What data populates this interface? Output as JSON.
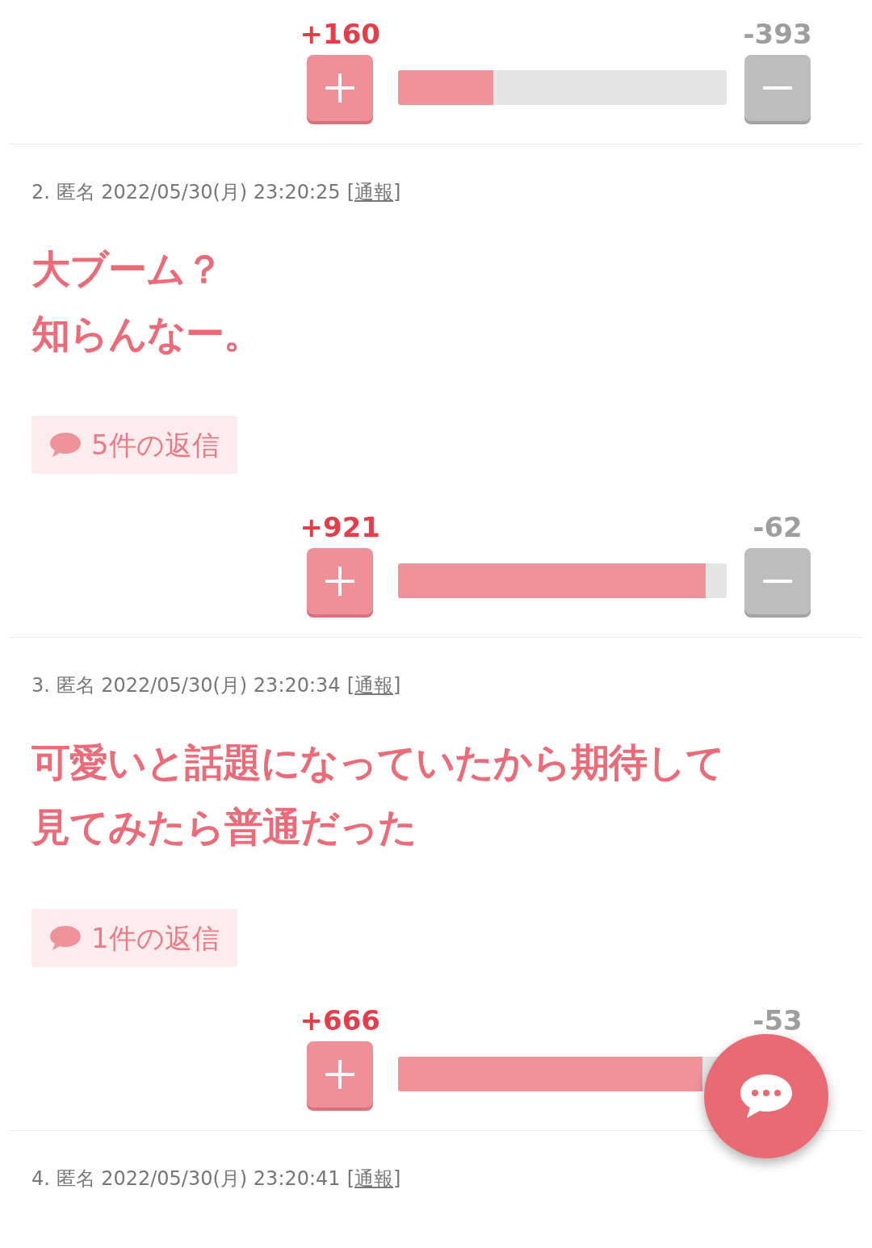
{
  "first_vote": {
    "plus": "+160",
    "minus": "-393",
    "level": 0.29,
    "minus_hidden": false
  },
  "comments": [
    {
      "number": "2.",
      "author": "匿名",
      "date": "2022/05/30(月) 23:20:25",
      "report": "[通報]",
      "lines": [
        "大ブーム？",
        "知らんなー。"
      ],
      "replies": "5件の返信",
      "vote": {
        "plus": "+921",
        "minus": "-62",
        "level": 0.937,
        "minus_hidden": false
      }
    },
    {
      "number": "3.",
      "author": "匿名",
      "date": "2022/05/30(月) 23:20:34",
      "report": "[通報]",
      "lines": [
        "可愛いと話題になっていたから期待して",
        "見てみたら普通だった"
      ],
      "replies": "1件の返信",
      "vote": {
        "plus": "+666",
        "minus": "-53",
        "level": 0.926,
        "minus_hidden": true
      }
    },
    {
      "number": "4.",
      "author": "匿名",
      "date": "2022/05/30(月) 23:20:41",
      "report": "[通報]"
    }
  ]
}
